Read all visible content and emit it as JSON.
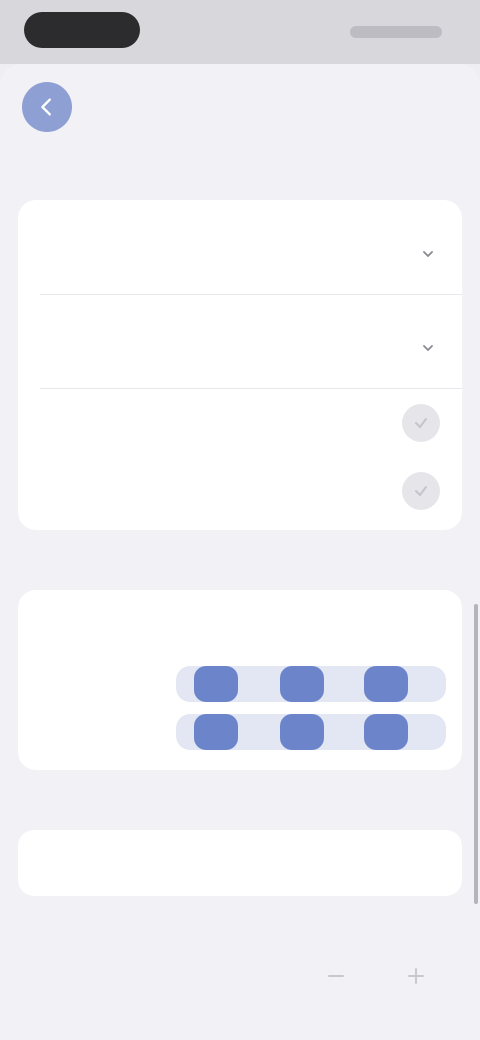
{
  "status_bar": {
    "time": "",
    "indicators": ""
  },
  "header": {
    "title": "",
    "subtitle": "",
    "back_icon": "chevron-left-icon"
  },
  "time_section": {
    "label": "",
    "rows": [
      {
        "label": "",
        "value": ""
      },
      {
        "label": "",
        "value": ""
      }
    ],
    "toggles": [
      {
        "label": "",
        "checked": false
      },
      {
        "label": "",
        "checked": false
      }
    ]
  },
  "days_section": {
    "label": "",
    "columns": [
      "",
      "",
      ""
    ],
    "slots": [
      {
        "label": "",
        "values": [
          true,
          true,
          true
        ]
      },
      {
        "label": "",
        "values": [
          true,
          true,
          true
        ]
      }
    ]
  },
  "note_section": {
    "label": "",
    "value": ""
  },
  "footer": {
    "icons": [
      "minus-icon",
      "plus-icon"
    ]
  },
  "colors": {
    "accent": "#6c84c9",
    "back_button": "#8e9fd3",
    "background": "#f2f2f6",
    "card": "#ffffff"
  }
}
